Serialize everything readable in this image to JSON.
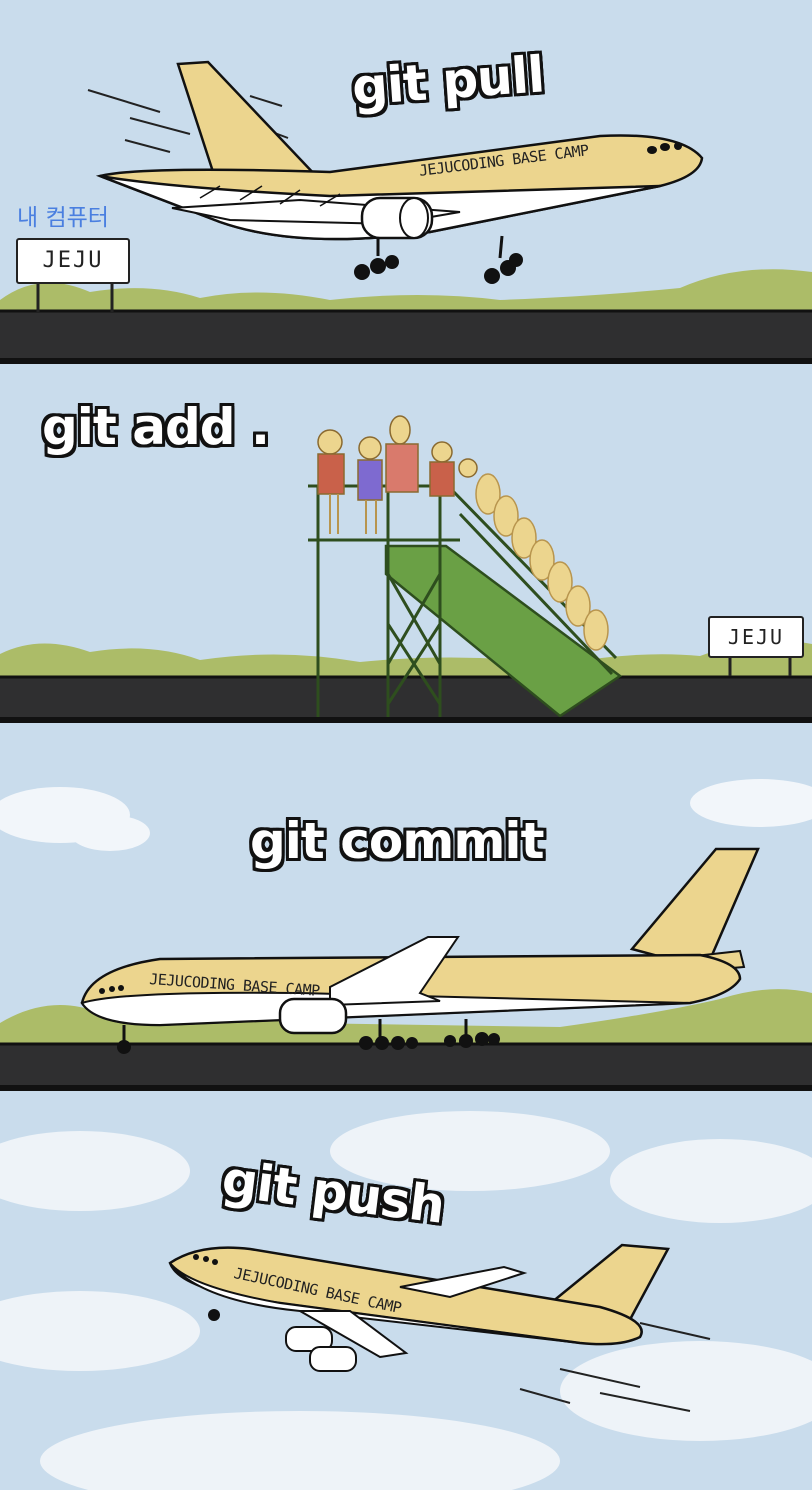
{
  "panels": [
    {
      "caption": "git pull"
    },
    {
      "caption": "git add ."
    },
    {
      "caption": "git commit"
    },
    {
      "caption": "git push"
    }
  ],
  "labels": {
    "my_computer": "내 컴퓨터",
    "sign_1": "JEJU",
    "sign_2": "JEJU",
    "plane_1": "JEJUCODING BASE CAMP",
    "plane_3": "JEJUCODING BASE CAMP",
    "plane_4": "JEJUCODING BASE CAMP"
  },
  "colors": {
    "sky": "#c9dcec",
    "runway": "#2f2f30",
    "grass": "#a8b85a",
    "fuselage": "#ecd58e",
    "stairs": "#6aa045",
    "outline": "#111111"
  }
}
